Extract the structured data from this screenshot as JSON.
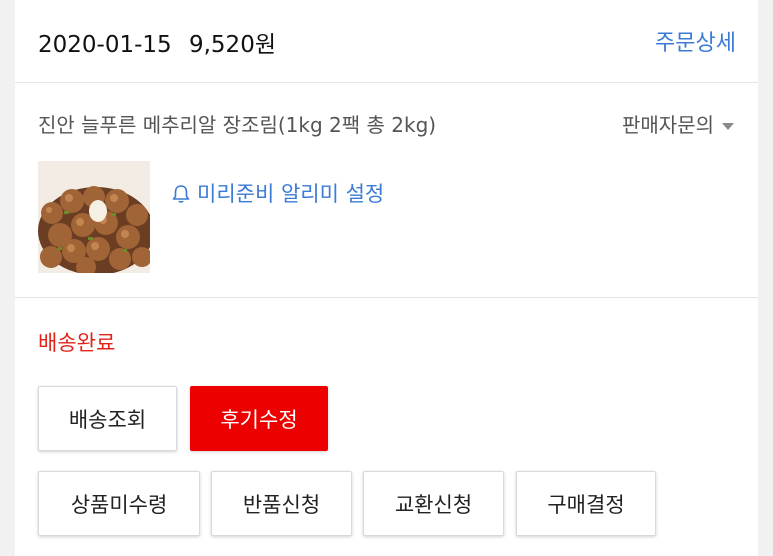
{
  "order": {
    "date": "2020-01-15",
    "price": "9,520원",
    "detail_link": "주문상세"
  },
  "product": {
    "name": "진안 늘푸른 메추리알 장조림(1kg 2팩 총 2kg)",
    "seller_inquiry": "판매자문의",
    "alarm_link": "미리준비 알리미 설정"
  },
  "status": {
    "label": "배송완료",
    "color": "#e2231a"
  },
  "actions": {
    "track": "배송조회",
    "edit_review": "후기수정",
    "not_received": "상품미수령",
    "return": "반품신청",
    "exchange": "교환신청",
    "confirm": "구매결정"
  },
  "colors": {
    "link": "#3b7bd6",
    "primary_button": "#ed0000"
  },
  "icons": [
    "bell-icon",
    "dropdown-caret-icon"
  ]
}
